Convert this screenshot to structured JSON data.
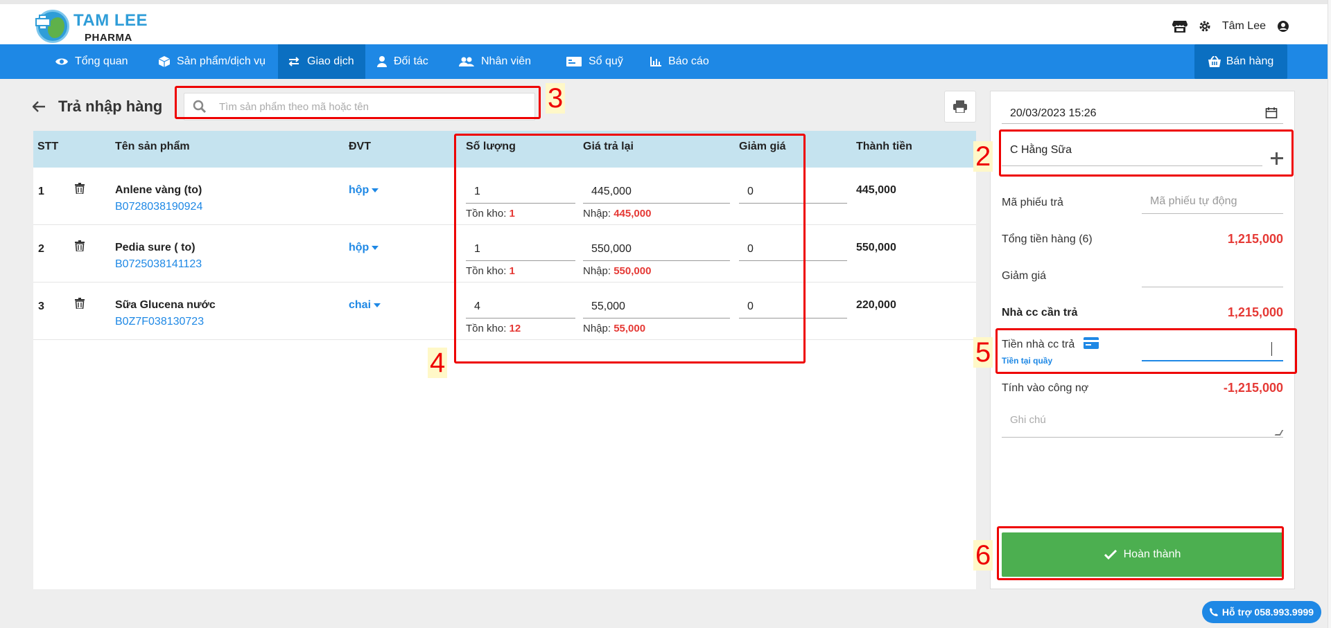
{
  "brand": {
    "title": "TAM LEE",
    "subtitle": "PHARMA"
  },
  "header": {
    "user_name": "Tâm Lee"
  },
  "nav": {
    "items": [
      {
        "label": "Tổng quan",
        "icon": "eye-icon"
      },
      {
        "label": "Sản phẩm/dịch vụ",
        "icon": "box-icon"
      },
      {
        "label": "Giao dịch",
        "icon": "exchange-icon"
      },
      {
        "label": "Đối tác",
        "icon": "user-tie-icon"
      },
      {
        "label": "Nhân viên",
        "icon": "users-icon"
      },
      {
        "label": "Sổ quỹ",
        "icon": "money-icon"
      },
      {
        "label": "Báo cáo",
        "icon": "chart-icon"
      }
    ],
    "active": "Giao dịch",
    "sell_label": "Bán hàng"
  },
  "page": {
    "title": "Trả nhập hàng",
    "search_placeholder": "Tìm sản phẩm theo mã hoặc tên"
  },
  "table": {
    "headers": {
      "stt": "STT",
      "name": "Tên sản phẩm",
      "unit": "ĐVT",
      "qty": "Số lượng",
      "price": "Giá trả lại",
      "discount": "Giảm giá",
      "total": "Thành tiền"
    },
    "stock_label": "Tồn kho:",
    "import_label": "Nhập:",
    "rows": [
      {
        "stt": "1",
        "name": "Anlene vàng (to)",
        "code": "B0728038190924",
        "unit": "hộp",
        "qty": "1",
        "price": "445,000",
        "discount": "0",
        "stock": "1",
        "import_price": "445,000",
        "total": "445,000"
      },
      {
        "stt": "2",
        "name": "Pedia sure ( to)",
        "code": "B0725038141123",
        "unit": "hộp",
        "qty": "1",
        "price": "550,000",
        "discount": "0",
        "stock": "1",
        "import_price": "550,000",
        "total": "550,000"
      },
      {
        "stt": "3",
        "name": "Sữa Glucena nước",
        "code": "B0Z7F038130723",
        "unit": "chai",
        "qty": "4",
        "price": "55,000",
        "discount": "0",
        "stock": "12",
        "import_price": "55,000",
        "total": "220,000"
      }
    ]
  },
  "side": {
    "datetime": "20/03/2023 15:26",
    "supplier": "C Hằng Sữa",
    "return_code_label": "Mã phiếu trả",
    "return_code_placeholder": "Mã phiếu tự động",
    "goods_total_label": "Tổng tiền hàng (6)",
    "goods_total": "1,215,000",
    "discount_label": "Giảm giá",
    "supplier_due_label": "Nhà cc cần trả",
    "supplier_due": "1,215,000",
    "supplier_pay_label": "Tiền nhà cc trả",
    "supplier_pay_sub": "Tiền tại quầy",
    "debt_label": "Tính vào công nợ",
    "debt": "-1,215,000",
    "note_placeholder": "Ghi chú",
    "done_label": "Hoàn thành"
  },
  "annotations": [
    "2",
    "3",
    "4",
    "5",
    "6"
  ],
  "support": {
    "label": "Hỗ trợ 058.993.9999"
  },
  "colors": {
    "primary": "#1e88e5",
    "primary_dark": "#0b6fc1",
    "accent_red": "#e53935",
    "success": "#4caf50",
    "table_head": "#c5e3ef"
  }
}
